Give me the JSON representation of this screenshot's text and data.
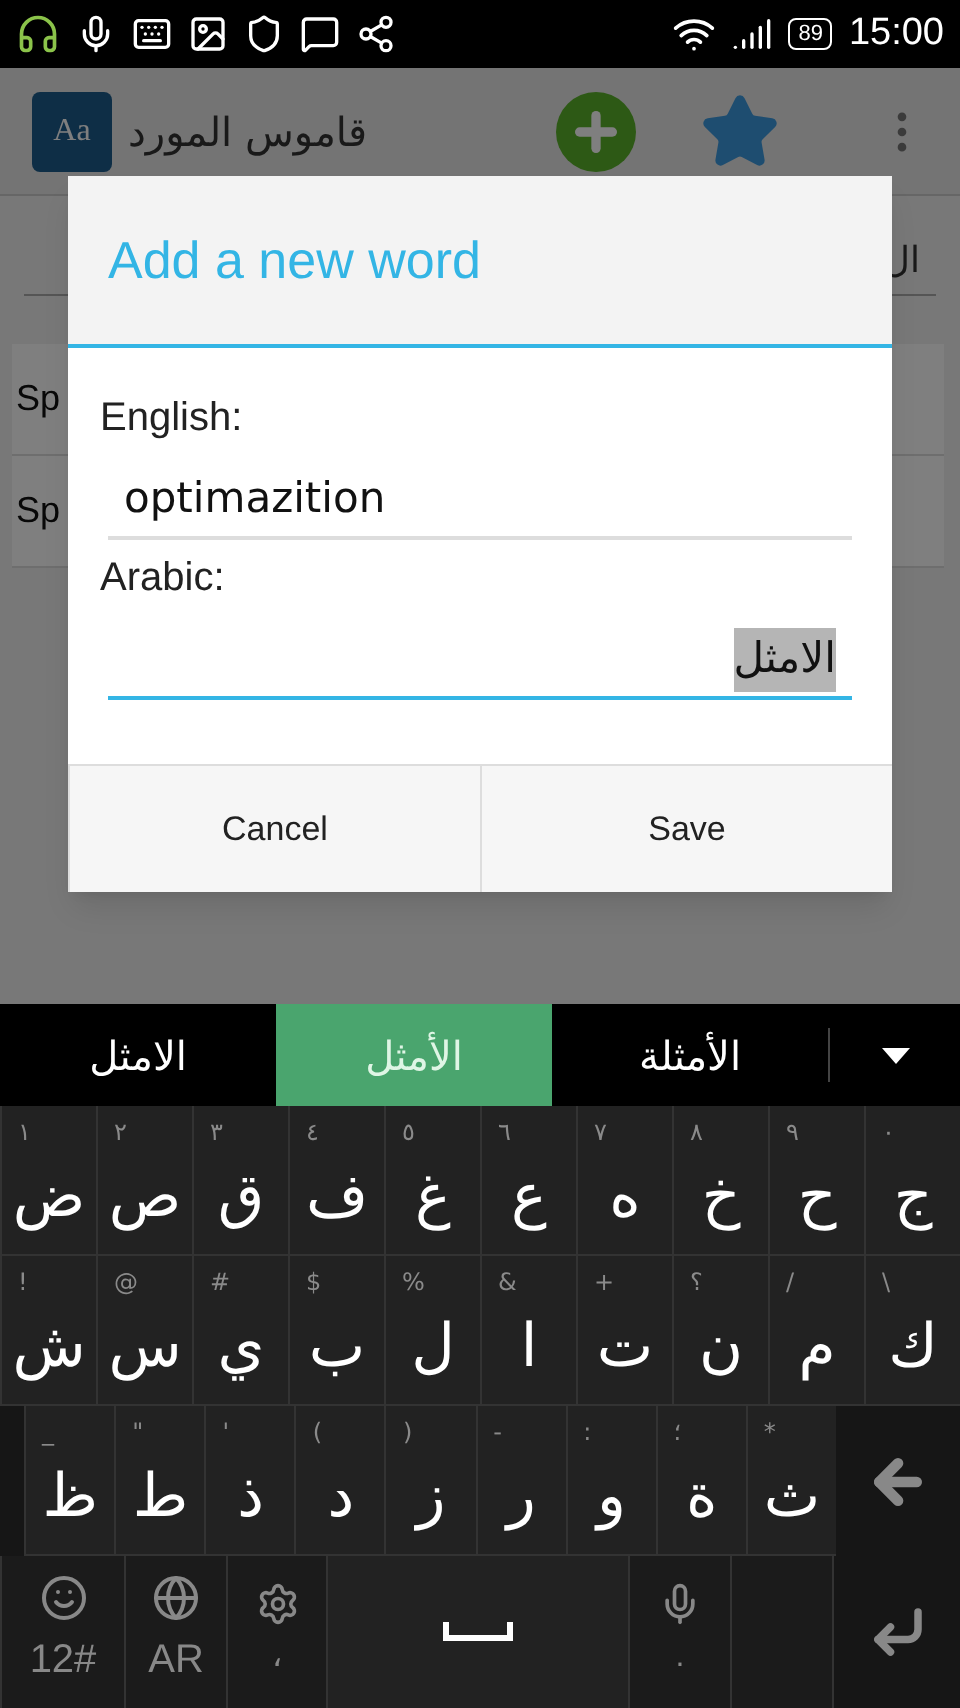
{
  "status_bar": {
    "battery": "89",
    "time": "15:00"
  },
  "app_bar": {
    "logo": "Aa",
    "title": "قاموس المورد"
  },
  "background": {
    "search_text": "ال",
    "list_items": [
      "Sp",
      "Sp"
    ]
  },
  "dialog": {
    "title": "Add a new word",
    "fields": [
      {
        "label": "English:",
        "value": "optimazition",
        "focused": false,
        "composing": false
      },
      {
        "label": "Arabic:",
        "value": "الامثل",
        "focused": true,
        "composing": true
      }
    ],
    "buttons": [
      "Save",
      "Cancel"
    ]
  },
  "suggestions": [
    {
      "text": "الأمثلة",
      "selected": false
    },
    {
      "text": "الأمثل",
      "selected": true
    },
    {
      "text": "الامثل",
      "selected": false
    }
  ],
  "keyboard": {
    "rows": [
      {
        "keys": [
          {
            "label": "ج",
            "hint": "٠"
          },
          {
            "label": "ح",
            "hint": "٩"
          },
          {
            "label": "خ",
            "hint": "٨"
          },
          {
            "label": "ه",
            "hint": "٧"
          },
          {
            "label": "ع",
            "hint": "٦"
          },
          {
            "label": "غ",
            "hint": "٥"
          },
          {
            "label": "ف",
            "hint": "٤"
          },
          {
            "label": "ق",
            "hint": "٣"
          },
          {
            "label": "ص",
            "hint": "٢"
          },
          {
            "label": "ض",
            "hint": "١"
          }
        ]
      },
      {
        "keys": [
          {
            "label": "ك",
            "hint": "\\"
          },
          {
            "label": "م",
            "hint": "/"
          },
          {
            "label": "ن",
            "hint": "؟"
          },
          {
            "label": "ت",
            "hint": "+"
          },
          {
            "label": "ا",
            "hint": "&"
          },
          {
            "label": "ل",
            "hint": "%"
          },
          {
            "label": "ب",
            "hint": "$"
          },
          {
            "label": "ي",
            "hint": "#"
          },
          {
            "label": "س",
            "hint": "@"
          },
          {
            "label": "ش",
            "hint": "!"
          }
        ]
      },
      {
        "keys": [
          {
            "label": "ث",
            "hint": "*"
          },
          {
            "label": "ة",
            "hint": "؛"
          },
          {
            "label": "و",
            "hint": ":"
          },
          {
            "label": "ر",
            "hint": "-"
          },
          {
            "label": "ز",
            "hint": ")"
          },
          {
            "label": "د",
            "hint": "("
          },
          {
            "label": "ذ",
            "hint": "'"
          },
          {
            "label": "ط",
            "hint": "\""
          },
          {
            "label": "ظ",
            "hint": "_"
          }
        ]
      }
    ],
    "bottom_row": [
      {
        "kind": "enter"
      },
      {
        "kind": "blank"
      },
      {
        "kind": "mic",
        "label": "."
      },
      {
        "kind": "space"
      },
      {
        "kind": "settings",
        "label": "،"
      },
      {
        "kind": "globe",
        "label": "AR"
      },
      {
        "kind": "emoji",
        "label": "12#"
      }
    ]
  }
}
